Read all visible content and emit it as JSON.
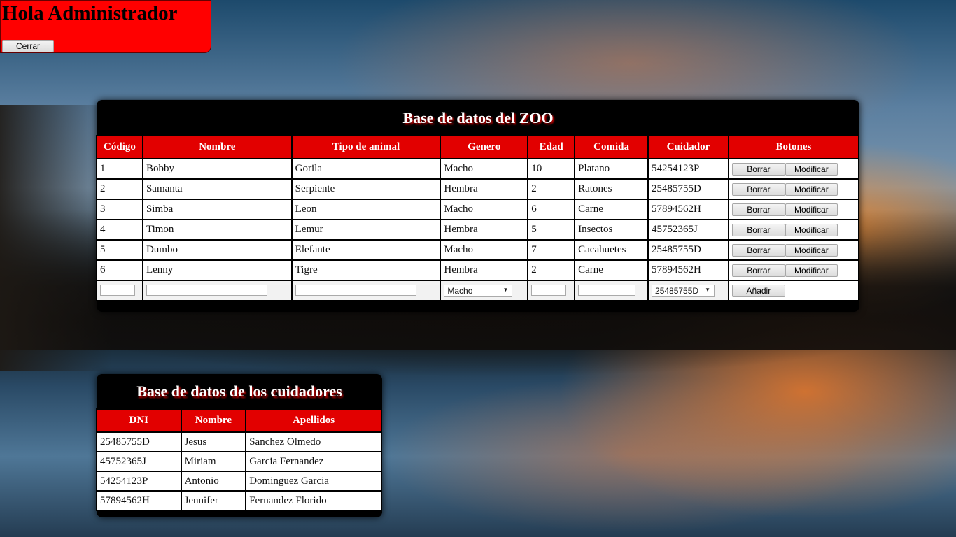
{
  "header": {
    "greeting": "Hola Administrador",
    "logout_label": "Cerrar"
  },
  "zoo": {
    "title": "Base de datos del ZOO",
    "columns": [
      "Código",
      "Nombre",
      "Tipo de animal",
      "Genero",
      "Edad",
      "Comida",
      "Cuidador",
      "Botones"
    ],
    "rows": [
      [
        "1",
        "Bobby",
        "Gorila",
        "Macho",
        "10",
        "Platano",
        "54254123P"
      ],
      [
        "2",
        "Samanta",
        "Serpiente",
        "Hembra",
        "2",
        "Ratones",
        "25485755D"
      ],
      [
        "3",
        "Simba",
        "Leon",
        "Macho",
        "6",
        "Carne",
        "57894562H"
      ],
      [
        "4",
        "Timon",
        "Lemur",
        "Hembra",
        "5",
        "Insectos",
        "45752365J"
      ],
      [
        "5",
        "Dumbo",
        "Elefante",
        "Macho",
        "7",
        "Cacahuetes",
        "25485755D"
      ],
      [
        "6",
        "Lenny",
        "Tigre",
        "Hembra",
        "2",
        "Carne",
        "57894562H"
      ]
    ],
    "delete_label": "Borrar",
    "modify_label": "Modificar",
    "new_row": {
      "genero_selected": "Macho",
      "cuidador_selected": "25485755D",
      "add_label": "Añadir"
    }
  },
  "cuidadores": {
    "title": "Base de datos de los cuidadores",
    "columns": [
      "DNI",
      "Nombre",
      "Apellidos"
    ],
    "rows": [
      [
        "25485755D",
        "Jesus",
        "Sanchez Olmedo"
      ],
      [
        "45752365J",
        "Miriam",
        "Garcia Fernandez"
      ],
      [
        "54254123P",
        "Antonio",
        "Dominguez Garcia"
      ],
      [
        "57894562H",
        "Jennifer",
        "Fernandez Florido"
      ]
    ]
  },
  "colors": {
    "header_red": "#ff0000",
    "table_header_red": "#e20000",
    "panel_black": "#000000"
  }
}
